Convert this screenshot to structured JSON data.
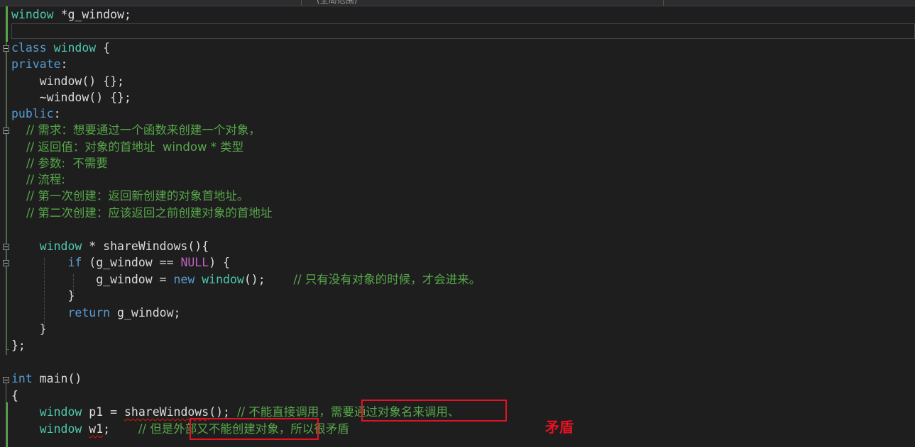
{
  "top_bar": {
    "scope_label": "(全局范围)"
  },
  "code": {
    "l1": [
      "window",
      " *g_window;"
    ],
    "l3": [
      "class",
      " ",
      "window",
      " {"
    ],
    "l4": [
      "private",
      ":"
    ],
    "l5": "    window() {};",
    "l6": "    ~window() {};",
    "l7": [
      "public",
      ":"
    ],
    "l8": "    // 需求：想要通过一个函数来创建一个对象，",
    "l9": "    // 返回值：对象的首地址  window * 类型",
    "l10": "    // 参数:  不需要",
    "l11": "    // 流程:",
    "l12": "    // 第一次创建：返回新创建的对象首地址。",
    "l13": "    // 第二次创建：应该返回之前创建对象的首地址",
    "l15": [
      "    ",
      "window",
      " * shareWindows(){"
    ],
    "l16": [
      "        ",
      "if",
      " (g_window == ",
      "NULL",
      ") {"
    ],
    "l17": [
      "            g_window = ",
      "new",
      " ",
      "window",
      "();    ",
      "// 只有没有对象的时候，才会进来。"
    ],
    "l18": "        }",
    "l19": [
      "        ",
      "return",
      " g_window;"
    ],
    "l20": "    }",
    "l21": "};",
    "l23": [
      "int",
      " main()"
    ],
    "l24": "{",
    "l25": [
      "    ",
      "window",
      " p1 = ",
      "shareWindows",
      "(); ",
      "// 不能直接调用，",
      "需要通过对象名来调用、"
    ],
    "l26": [
      "    ",
      "window",
      " ",
      "w1",
      ";    ",
      "// 但是",
      "外部又不能创建对象，",
      "所以很矛盾"
    ]
  },
  "annotation": {
    "label": "矛盾",
    "color": "#e81123"
  },
  "colors": {
    "background": "#1e1e1e",
    "keyword": "#569cd6",
    "type": "#4ec9b0",
    "comment": "#57a64a",
    "macro": "#bd63c5",
    "text": "#dcdcdc"
  }
}
